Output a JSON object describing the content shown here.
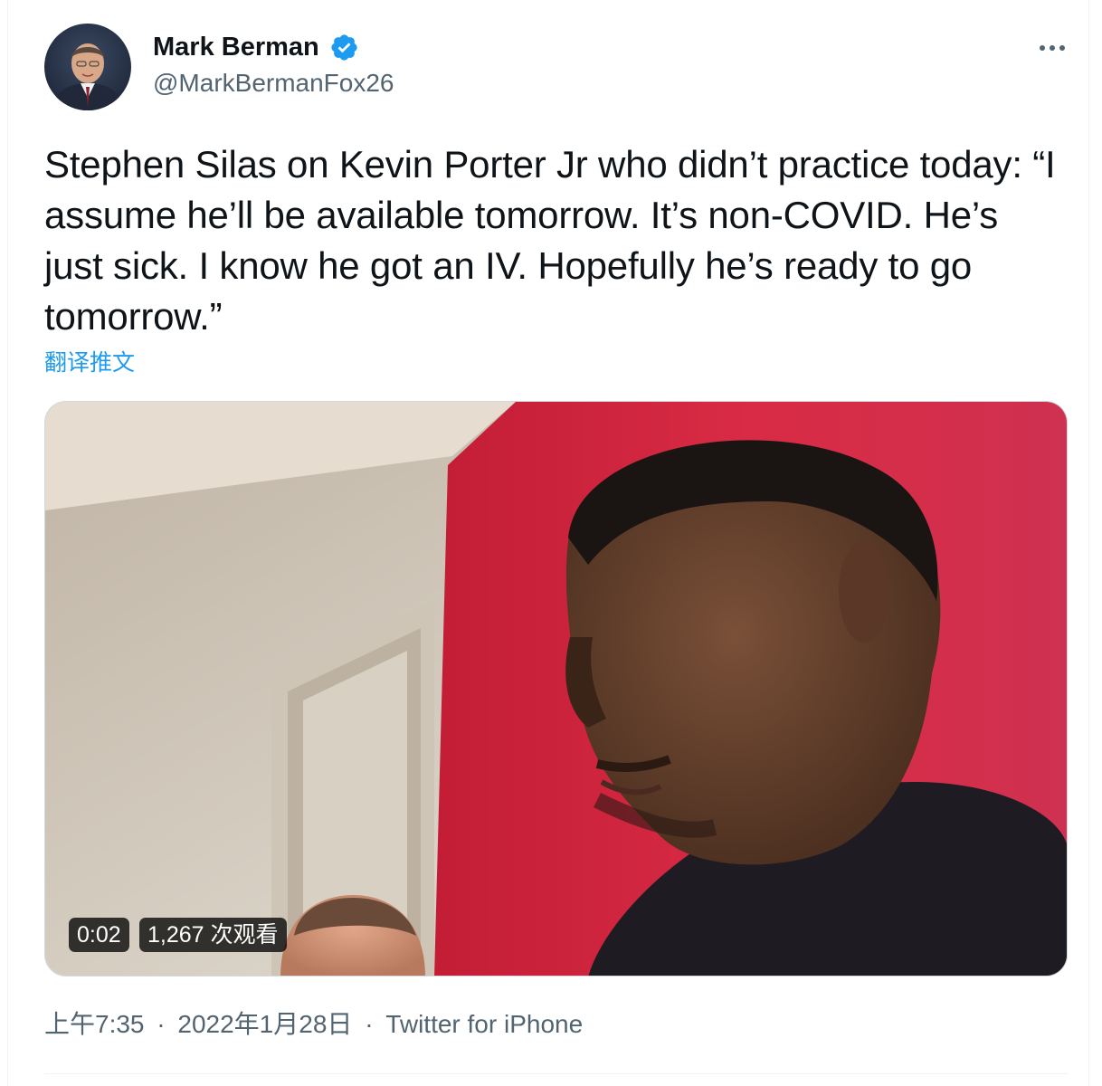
{
  "author": {
    "display_name": "Mark Berman",
    "handle": "@MarkBermanFox26",
    "verified": true
  },
  "tweet": {
    "text": "Stephen Silas on Kevin Porter Jr who didn’t practice today: “I assume he’ll be available tomorrow. It’s non-COVID. He’s just sick. I know he got an IV. Hopefully he’s ready to go tomorrow.”",
    "translate_label": "翻译推文"
  },
  "video": {
    "duration": "0:02",
    "views": "1,267 次观看"
  },
  "meta": {
    "time": "上午7:35",
    "date": "2022年1月28日",
    "source": "Twitter for iPhone",
    "separator": "·"
  },
  "colors": {
    "accent": "#1d9bf0",
    "secondary_text": "#536471",
    "primary_text": "#0f1419",
    "border": "#cfd9de"
  },
  "icons": {
    "verified": "verified-badge-icon",
    "more": "more-options-icon"
  }
}
